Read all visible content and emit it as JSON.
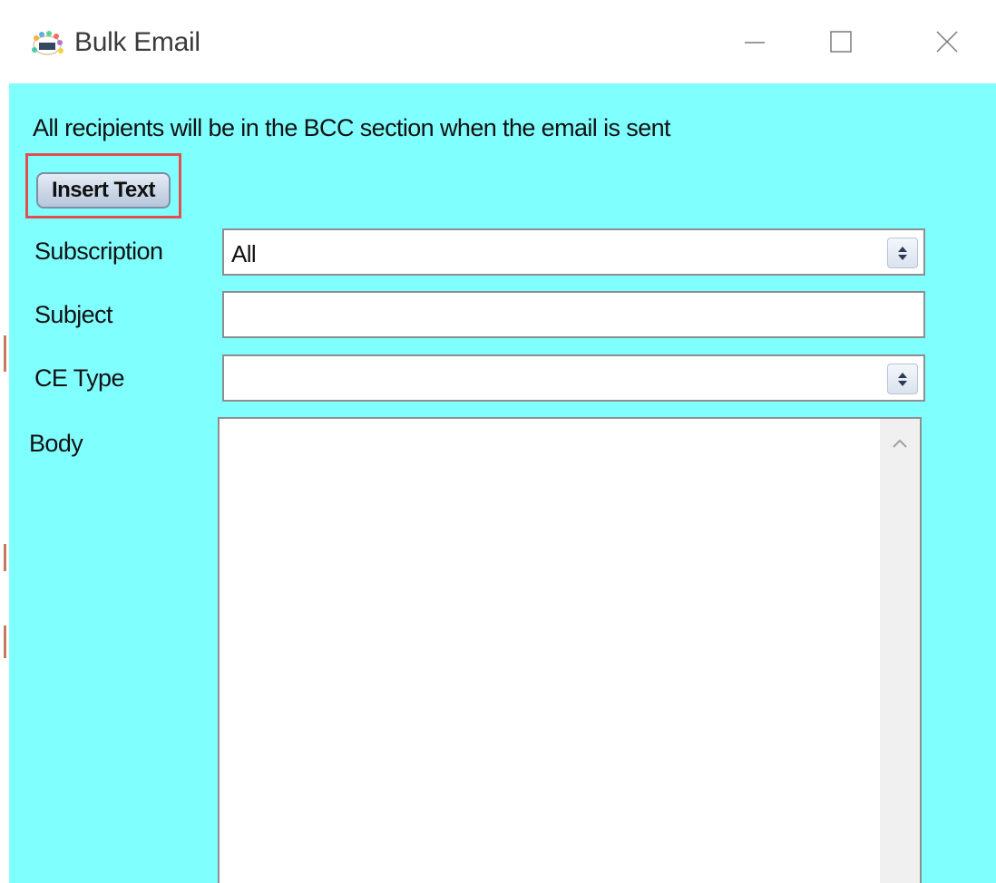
{
  "window": {
    "title": "Bulk Email",
    "icon": "app-logo-icon",
    "controls": [
      "minimize-icon",
      "maximize-icon",
      "close-icon"
    ]
  },
  "info": {
    "text": "All recipients will be in the BCC section when the email is sent"
  },
  "toolbar": {
    "insert_text_label": "Insert Text"
  },
  "form": {
    "subscription": {
      "label": "Subscription",
      "value": "All"
    },
    "subject": {
      "label": "Subject",
      "value": ""
    },
    "ce_type": {
      "label": "CE Type",
      "value": ""
    },
    "body": {
      "label": "Body",
      "value": ""
    }
  },
  "colors": {
    "client_background": "#80ffff",
    "highlight_border": "#e05050"
  }
}
